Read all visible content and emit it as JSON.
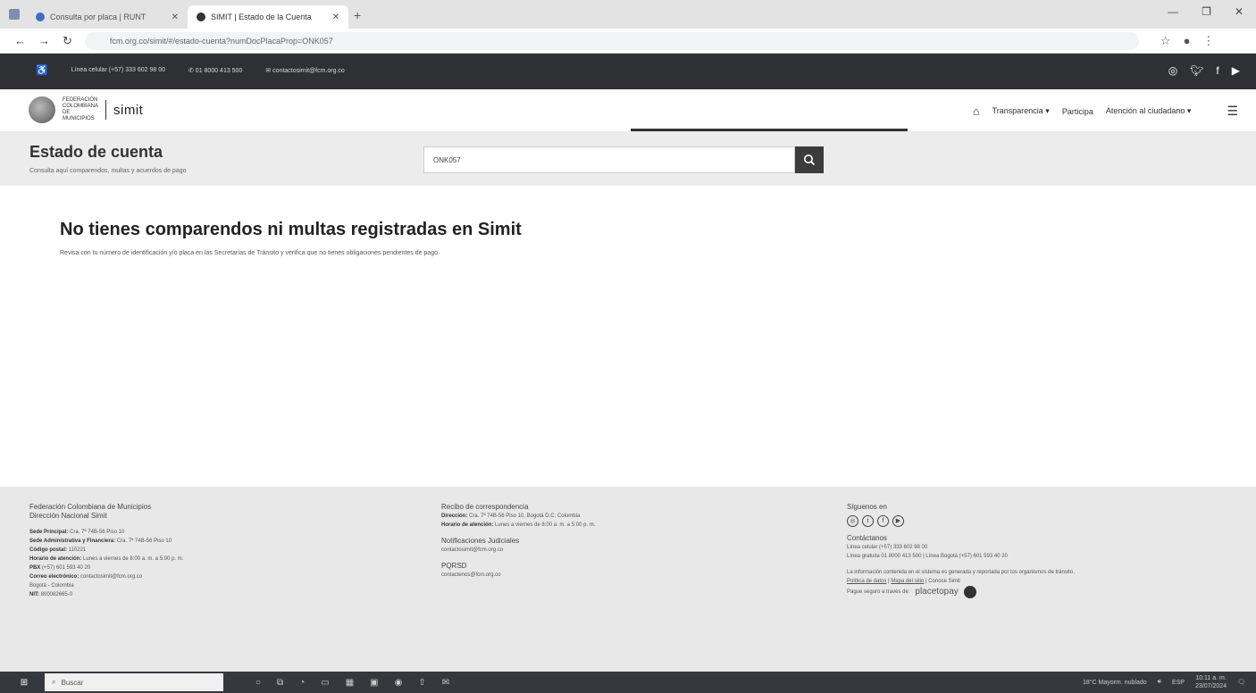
{
  "browser": {
    "tabs": [
      {
        "label": "Consulta por placa | RUNT",
        "active": false
      },
      {
        "label": "SIMIT | Estado de la Cuenta",
        "active": true
      }
    ],
    "url": "fcm.org.co/simit/#/estado-cuenta?numDocPlacaProp=ONK057"
  },
  "site": {
    "topbar": {
      "accessibility_icon": "accessibility-icon",
      "linea_celular": "Línea celular (+57) 333 602 98 00",
      "telefono": "01 8000 413 500",
      "correo": "contactosimit@fcm.org.co",
      "social_icons": [
        "instagram-icon",
        "twitter-icon",
        "facebook-icon",
        "youtube-icon"
      ]
    },
    "header": {
      "logo_text": "simit",
      "logo_subtext": "FEDERACIÓN COLOMBIANA DE MUNICIPIOS",
      "menu": [
        {
          "label": "Transparencia",
          "dropdown": true
        },
        {
          "label": "Participa",
          "dropdown": false
        },
        {
          "label": "Atención al ciudadano",
          "dropdown": true
        }
      ]
    },
    "hero": {
      "title": "Estado de cuenta",
      "subtitle": "Consulta aquí comparendos, multas y acuerdos de pago",
      "search_value": "ONK057"
    },
    "message": {
      "title": "No tienes comparendos ni multas registradas en Simit",
      "body": "Revisa con tu número de identificación y/o placa en las Secretarías de Tránsito y verifica que no tienes obligaciones pendientes de pago"
    },
    "footer": {
      "col1": {
        "title1": "Federación Colombiana de Municipios",
        "title2": "Dirección Nacional Simit",
        "sede_principal_label": "Sede Principal:",
        "sede_principal": "Cra. 7ª 74B-56 Piso 10",
        "sede_admin_label": "Sede Administrativa y Financiera:",
        "sede_admin": "Cra. 7ª 74B-56 Piso 10",
        "postal_label": "Código postal:",
        "postal": "110221",
        "horario_label": "Horario de atención:",
        "horario": "Lunes a viernes de 8:00 a. m. a 5:00 p. m.",
        "pbx_label": "PBX",
        "pbx": "(+57) 601 593 40 20",
        "correo_label": "Correo electrónico:",
        "correo": "contactosimit@fcm.org.co",
        "ciudad": "Bogotá - Colombia",
        "nit_label": "NIT:",
        "nit": "800082665-0"
      },
      "col2": {
        "recibo_title": "Recibo de correspondencia",
        "direccion_label": "Dirección:",
        "direccion": "Cra. 7ª 74B-56 Piso 10, Bogotá D.C. Colombia",
        "horario_label": "Horario de atención:",
        "horario": "Lunes a viernes de 8:00 a. m. a 5:00 p. m.",
        "notif_title": "Notificaciones Judiciales",
        "notif_email": "contactosimit@fcm.org.co",
        "pqrsd_title": "PQRSD",
        "pqrsd_email": "contactenos@fcm.org.co"
      },
      "col3": {
        "siguenos": "Síguenos en",
        "social_icons": [
          "instagram-icon",
          "twitter-icon",
          "facebook-icon",
          "youtube-icon"
        ],
        "contactanos": "Contáctanos",
        "linea_celular": "Línea celular (+57) 333 602 98 00",
        "linea_gratuita": "Línea gratuita 01 8000 413 500 | Línea Bogotá (+57) 601 593 40 20",
        "info": "La información contenida en el sistema es generada y reportada por los organismos de tránsito.",
        "politica": "Política de datos",
        "mapa": "Mapa del sitio",
        "conoce": "Conoce Simit",
        "pague": "Pague seguro a través de:",
        "placetopay": "placetopay"
      }
    }
  },
  "taskbar": {
    "search_placeholder": "Buscar",
    "weather": "18°C  Mayorm. nublado",
    "lang": "ESP",
    "time": "10:11 a. m.",
    "date": "23/07/2024"
  }
}
